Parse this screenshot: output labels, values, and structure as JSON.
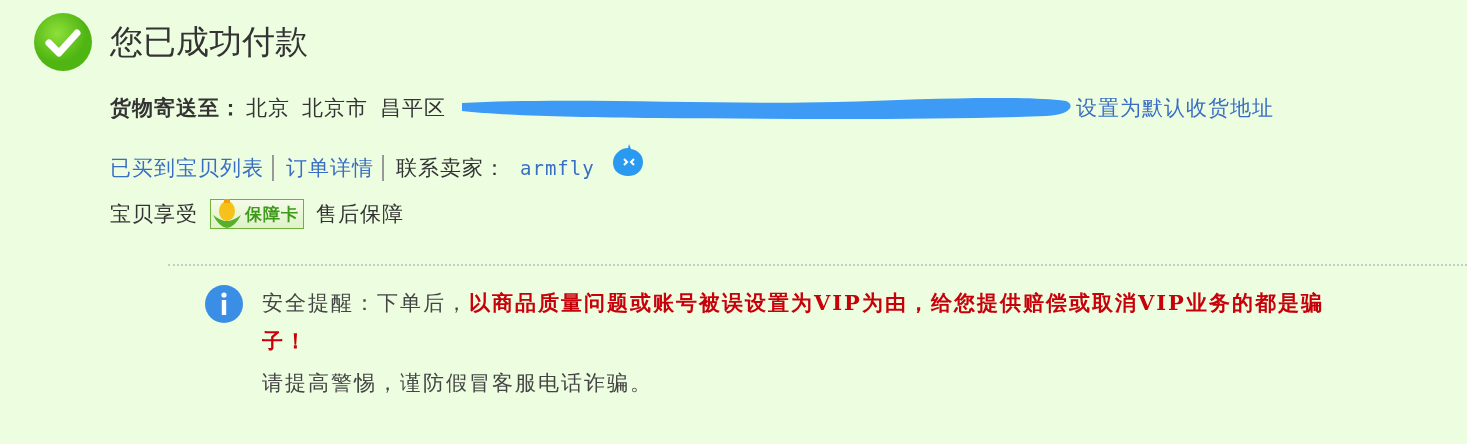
{
  "title": "您已成功付款",
  "address": {
    "label": "货物寄送至：",
    "parts": [
      "北京",
      "北京市",
      "昌平区"
    ],
    "redacted": true,
    "link": "设置为默认收货地址"
  },
  "links": [
    {
      "text": "已买到宝贝列表",
      "kind": "link"
    },
    {
      "text": "订单详情",
      "kind": "link"
    },
    {
      "text": "联系卖家：",
      "kind": "label"
    },
    {
      "text": "armfly",
      "kind": "seller"
    }
  ],
  "guarantee": {
    "before": "宝贝享受",
    "badge": "保障卡",
    "after": "售后保障"
  },
  "notice": {
    "text": "安全提醒：下单后，**以商品质量问题或账号被误设置为VIP为由，给您提供赔偿或取消VIP业务的都是骗子！**",
    "tip": "请提高警惕，谨防假冒客服电话诈骗。"
  }
}
